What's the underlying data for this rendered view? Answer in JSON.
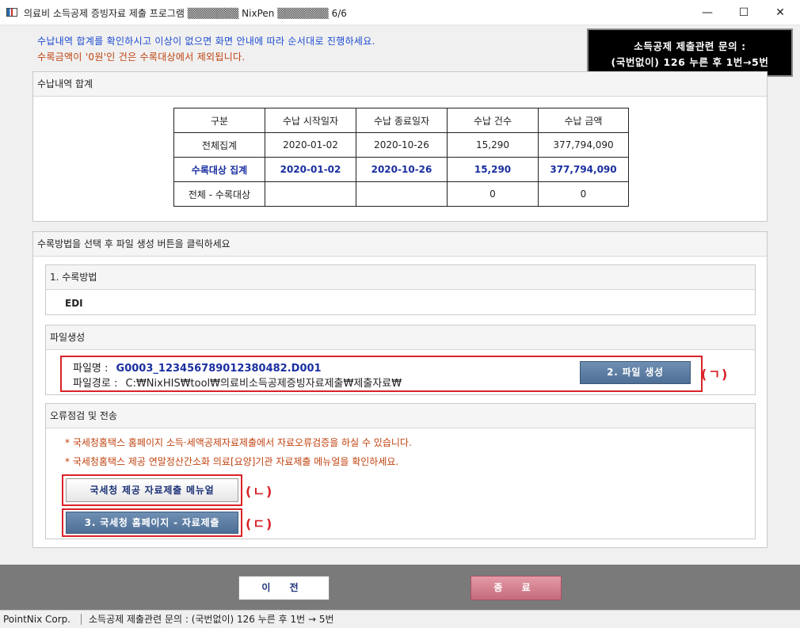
{
  "window": {
    "title": "의료비 소득공제 증빙자료 제출 프로그램 ▒▒▒▒▒▒▒ NixPen ▒▒▒▒▒▒▒  6/6",
    "minimize": "—",
    "maximize": "☐",
    "close": "✕"
  },
  "notice": {
    "line1": "수납내역 합계를 확인하시고 이상이 없으면 화면 안내에 따라 순서대로 진행하세요.",
    "line2": "수록금액이 '0원'인 건은 수록대상에서 제외됩니다."
  },
  "contact": {
    "line1": "소득공제 제출관련 문의 :",
    "line2": "(국번없이) 126 누른 후 1번→5번"
  },
  "summary": {
    "title": "수납내역 합계",
    "headers": [
      "구분",
      "수납 시작일자",
      "수납 종료일자",
      "수납 건수",
      "수납 금액"
    ],
    "rows": [
      [
        "전체집계",
        "2020-01-02",
        "2020-10-26",
        "15,290",
        "377,794,090"
      ],
      [
        "수록대상 집계",
        "2020-01-02",
        "2020-10-26",
        "15,290",
        "377,794,090"
      ],
      [
        "전체 - 수록대상",
        "",
        "",
        "0",
        "0"
      ]
    ]
  },
  "method": {
    "title": "수록방법을 선택 후 파일 생성 버튼을 클릭하세요",
    "section1_title": "1. 수록방법",
    "section1_value": "EDI",
    "file_title": "파일생성",
    "file_name_label": "파일명 :",
    "file_name": "G0003_1234567890123804​82.D001",
    "file_path_label": "파일경로 :",
    "file_path": "C:₩NixHIS₩tool₩의료비소득공제증빙자료제출₩제출자료₩",
    "create_button": "2. 파일 생성",
    "mark_a": "(ㄱ)"
  },
  "check": {
    "title": "오류점검 및 전송",
    "note1": "* 국세청홈택스 홈페이지 소득·세액공제자료제출에서 자료오류검증을 하실 수 있습니다.",
    "note2": "* 국세청홈택스 제공 연말정산간소화 의료[요양]기관 자료제출 메뉴얼을 확인하세요.",
    "manual_button": "국세청 제공 자료제출 메뉴얼",
    "mark_b": "(ㄴ)",
    "submit_button": "3. 국세청 홈페이지 - 자료제출",
    "mark_c": "(ㄷ)"
  },
  "footer": {
    "prev_button": "이 전",
    "close_button": "종 료"
  },
  "statusbar": {
    "company": "PointNix Corp.",
    "message": "소득공제 제출관련 문의 : (국번없이) 126 누른 후 1번 → 5번"
  },
  "colors": {
    "notice_blue": "#1c4bd1",
    "notice_orange": "#c0420f",
    "highlight_red": "#d9232a",
    "file_name_blue": "#1a2fa0",
    "button_blue": "#4e6e96",
    "button_pink": "#c56b7c"
  }
}
